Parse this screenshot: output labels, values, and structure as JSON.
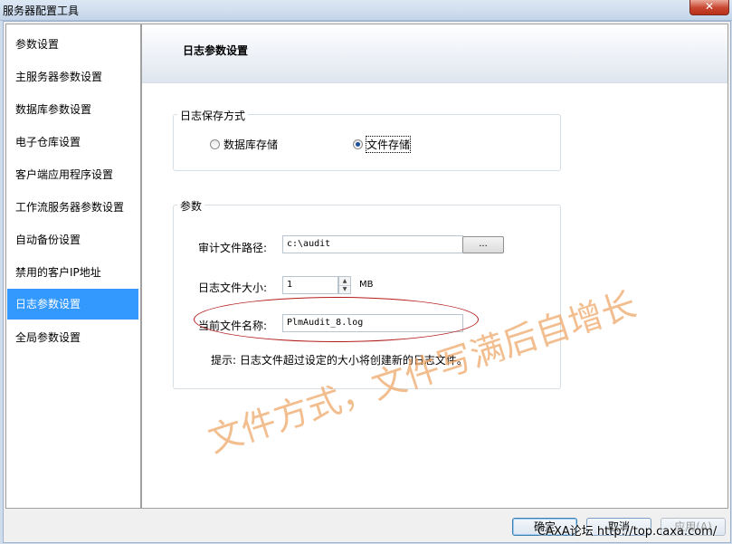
{
  "window": {
    "title": "服务器配置工具",
    "close_label": "✕"
  },
  "sidebar": {
    "items": [
      {
        "label": "参数设置",
        "selected": false
      },
      {
        "label": "主服务器参数设置",
        "selected": false
      },
      {
        "label": "数据库参数设置",
        "selected": false
      },
      {
        "label": "电子仓库设置",
        "selected": false
      },
      {
        "label": "客户端应用程序设置",
        "selected": false
      },
      {
        "label": "工作流服务器参数设置",
        "selected": false
      },
      {
        "label": "自动备份设置",
        "selected": false
      },
      {
        "label": "禁用的客户IP地址",
        "selected": false
      },
      {
        "label": "日志参数设置",
        "selected": true
      },
      {
        "label": "全局参数设置",
        "selected": false
      }
    ]
  },
  "panel": {
    "title": "日志参数设置",
    "storage_group": {
      "legend": "日志保存方式",
      "options": [
        {
          "label": "数据库存储",
          "checked": false
        },
        {
          "label": "文件存储",
          "checked": true
        }
      ]
    },
    "params_group": {
      "legend": "参数",
      "audit_path_label": "审计文件路径:",
      "audit_path_value": "c:\\audit",
      "browse_label": "...",
      "size_label": "日志文件大小:",
      "size_value": "1",
      "size_unit": "MB",
      "filename_label": "当前文件名称:",
      "filename_value": "PlmAudit_8.log",
      "hint": "提示: 日志文件超过设定的大小将创建新的日志文件。"
    }
  },
  "annotation": {
    "text": "文件方式，文件写满后自增长"
  },
  "buttons": {
    "ok": "确定",
    "cancel": "取消",
    "apply": "应用(A)"
  },
  "footer_watermark": "CAXA论坛 http://top.caxa.com/"
}
